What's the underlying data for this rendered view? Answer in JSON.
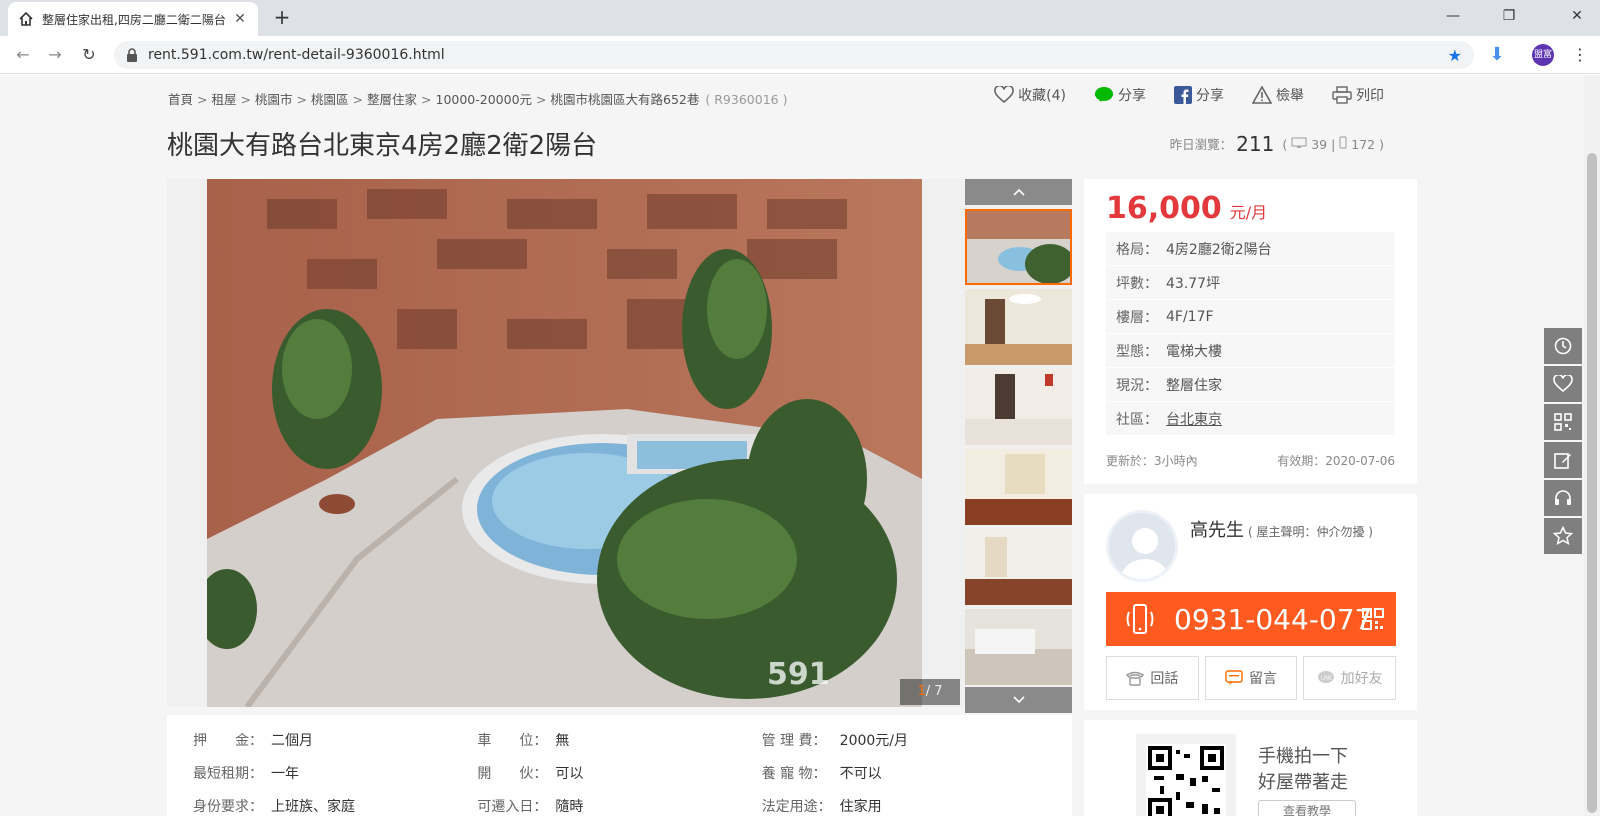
{
  "browser": {
    "tab_title": "整層住家出租,四房二廳二衛二陽台",
    "url": "rent.591.com.tw/rent-detail-9360016.html",
    "profile_initials": "盟富",
    "accent_color": "#1a73e8"
  },
  "breadcrumb": {
    "items": [
      "首頁",
      "租屋",
      "桃園市",
      "桃園區",
      "整層住家",
      "10000-20000元",
      "桃園市桃園區大有路652巷"
    ],
    "separator": ">",
    "code": "( R9360016 )"
  },
  "actions": {
    "favorite": "收藏(4)",
    "line_share": "分享",
    "fb_share": "分享",
    "report": "檢舉",
    "print": "列印"
  },
  "listing": {
    "title": "桃園大有路台北東京4房2廳2衛2陽台",
    "views_label": "昨日瀏覽：",
    "views_count": "211",
    "views_pc": "39",
    "views_mobile": "172",
    "views_open": "(",
    "views_sep": "|",
    "views_close": ")"
  },
  "gallery": {
    "counter_current": "1",
    "counter_total": "/ 7",
    "watermark": "591"
  },
  "price": {
    "amount": "16,000",
    "unit": "元/月",
    "attrs": [
      {
        "k": "格局：",
        "v": "4房2廳2衛2陽台"
      },
      {
        "k": "坪數：",
        "v": "43.77坪"
      },
      {
        "k": "樓層：",
        "v": "4F/17F"
      },
      {
        "k": "型態：",
        "v": "電梯大樓"
      },
      {
        "k": "現況：",
        "v": "整層住家"
      },
      {
        "k": "社區：",
        "v": "台北東京"
      }
    ],
    "updated": "更新於：3小時內",
    "valid": "有效期：2020-07-06",
    "color": "#e4393c"
  },
  "contact": {
    "name": "高先生",
    "note": "( 屋主聲明：仲介勿擾 )",
    "phone": "0931-044-077",
    "call": "回話",
    "message": "留言",
    "add_friend": "加好友",
    "button_color": "#ff5a1f"
  },
  "qr": {
    "line1": "手機拍一下",
    "line2": "好屋帶著走",
    "button": "查看教學"
  },
  "details": [
    [
      {
        "k": "押　　金：",
        "v": "二個月"
      },
      {
        "k": "車　　位：",
        "v": "無"
      },
      {
        "k": "管 理 費：",
        "v": "2000元/月"
      }
    ],
    [
      {
        "k": "最短租期：",
        "v": "一年"
      },
      {
        "k": "開　　伙：",
        "v": "可以"
      },
      {
        "k": "養 寵 物：",
        "v": "不可以"
      }
    ],
    [
      {
        "k": "身份要求：",
        "v": "上班族、家庭"
      },
      {
        "k": "可遷入日：",
        "v": "隨時"
      },
      {
        "k": "法定用途：",
        "v": "住家用"
      }
    ]
  ]
}
